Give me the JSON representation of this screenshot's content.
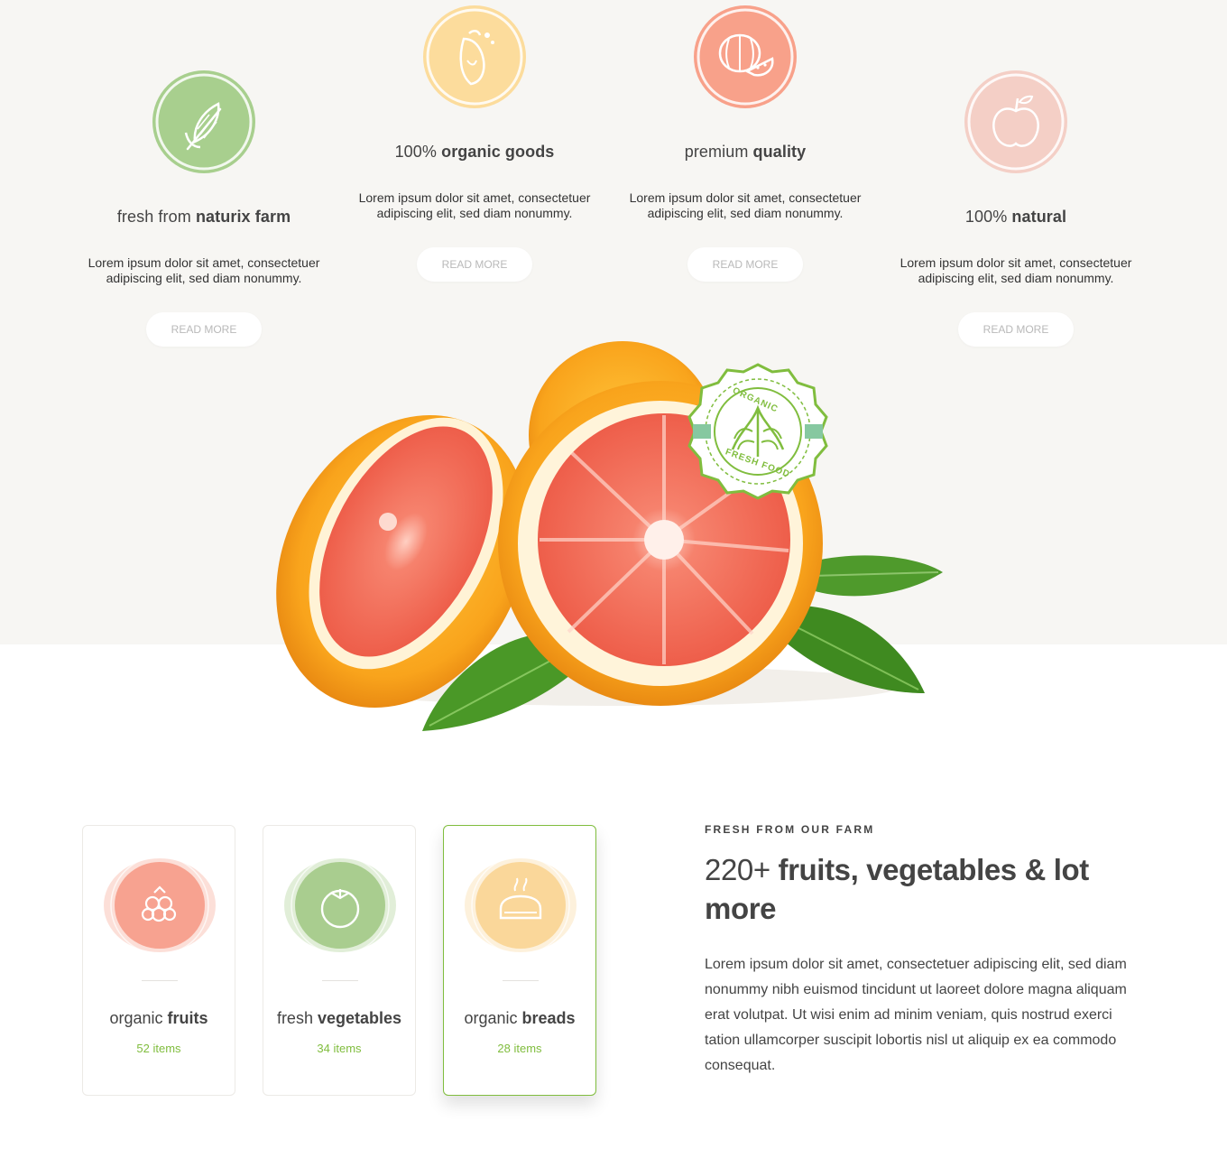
{
  "features": [
    {
      "title_light": "fresh from",
      "title_bold": "naturix farm",
      "desc": "Lorem ipsum dolor sit amet, consectetuer adipiscing elit, sed diam nonummy.",
      "button": "READ MORE",
      "icon": "corn-icon",
      "color": "#a8cf8e"
    },
    {
      "title_light": "100%",
      "title_bold": "organic goods",
      "desc": "Lorem ipsum dolor sit amet, consectetuer adipiscing elit, sed diam nonummy.",
      "button": "READ MORE",
      "icon": "juice-icon",
      "color": "#fcdc9c"
    },
    {
      "title_light": "premium",
      "title_bold": "quality",
      "desc": "Lorem ipsum dolor sit amet, consectetuer adipiscing elit, sed diam nonummy.",
      "button": "READ MORE",
      "icon": "watermelon-icon",
      "color": "#f8a18a"
    },
    {
      "title_light": "100%",
      "title_bold": "natural",
      "desc": "Lorem ipsum dolor sit amet, consectetuer adipiscing elit, sed diam nonummy.",
      "button": "READ MORE",
      "icon": "apple-icon",
      "color": "#f4cfc6"
    }
  ],
  "badge": {
    "top_text": "ORGANIC",
    "bottom_text": "FRESH FOOD",
    "color": "#80bd3e"
  },
  "categories": [
    {
      "name_light": "organic",
      "name_bold": "fruits",
      "count": "52 items",
      "icon": "raspberry-icon",
      "color": "#f7a290",
      "active": false
    },
    {
      "name_light": "fresh",
      "name_bold": "vegetables",
      "count": "34 items",
      "icon": "tomato-icon",
      "color": "#a9cd8f",
      "active": false
    },
    {
      "name_light": "organic",
      "name_bold": "breads",
      "count": "28 items",
      "icon": "bread-icon",
      "color": "#fad79a",
      "active": true
    }
  ],
  "about": {
    "eyebrow": "FRESH FROM OUR FARM",
    "heading_light": "220+",
    "heading_bold": "fruits, vegetables & lot more",
    "body": "Lorem ipsum dolor sit amet, consectetuer adipiscing elit, sed diam nonummy nibh euismod tincidunt ut laoreet dolore magna aliquam erat volutpat. Ut wisi enim ad minim veniam, quis nostrud exerci tation ullamcorper suscipit lobortis nisl ut aliquip ex ea commodo consequat."
  },
  "colors": {
    "accent": "#80bd3e",
    "band": "#f7f6f3"
  }
}
